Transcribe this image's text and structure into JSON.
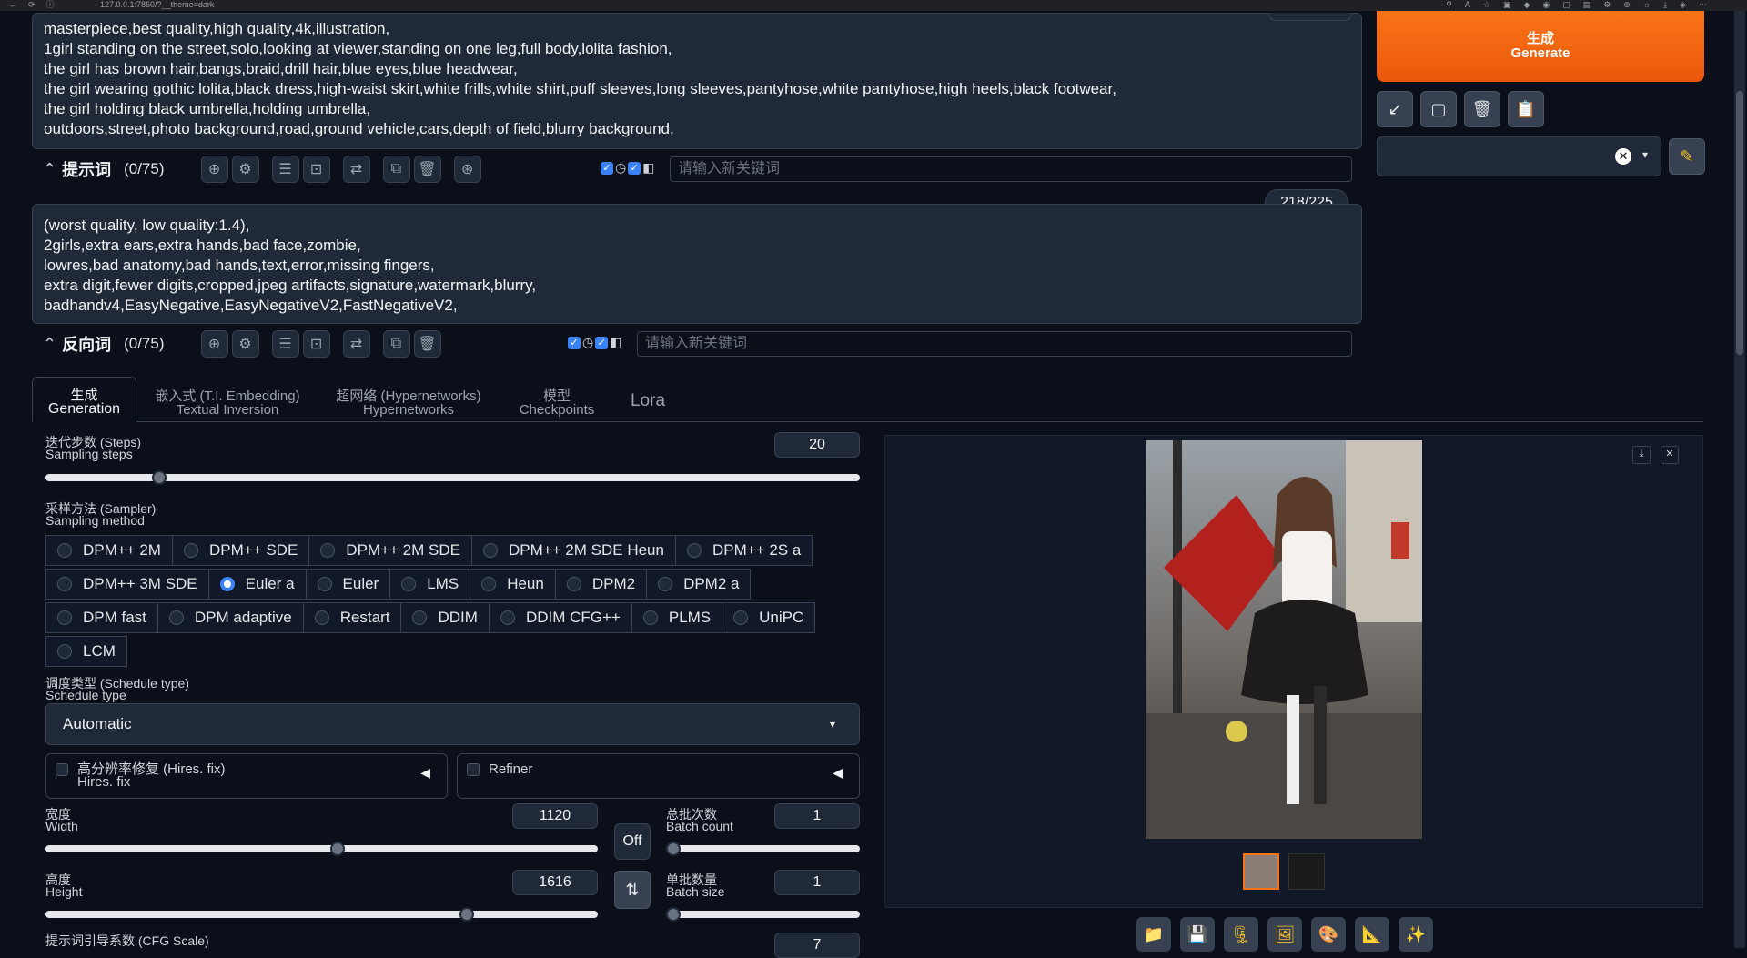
{
  "browser": {
    "url": "127.0.0.1:7860/?__theme=dark"
  },
  "positive": {
    "text": "masterpiece,best quality,high quality,4k,illustration,\n1girl standing on the street,solo,looking at viewer,standing on one leg,full body,lolita fashion,\nthe girl has brown hair,bangs,braid,drill hair,blue eyes,blue headwear,\nthe girl wearing gothic lolita,black dress,high-waist skirt,white frills,white shirt,puff sleeves,long sleeves,pantyhose,white pantyhose,high heels,black footwear,\nthe girl holding black umbrella,holding umbrella,\noutdoors,street,photo background,road,ground vehicle,cars,depth of field,blurry background,",
    "label": "提示词",
    "count": "(0/75)",
    "placeholder": "请输入新关键词"
  },
  "negative": {
    "token_counter": "218/225",
    "text": "(worst quality, low quality:1.4),\n2girls,extra ears,extra hands,bad face,zombie,\nlowres,bad anatomy,bad hands,text,error,missing fingers,\nextra digit,fewer digits,cropped,jpeg artifacts,signature,watermark,blurry,\nbadhandv4,EasyNegative,EasyNegativeV2,FastNegativeV2,",
    "label": "反向词",
    "count": "(0/75)",
    "placeholder": "请输入新关键词"
  },
  "generate": {
    "zh": "生成",
    "en": "Generate"
  },
  "tabs": [
    {
      "zh": "生成",
      "en": "Generation"
    },
    {
      "zh": "嵌入式 (T.I. Embedding)",
      "en": "Textual Inversion"
    },
    {
      "zh": "超网络 (Hypernetworks)",
      "en": "Hypernetworks"
    },
    {
      "zh": "模型",
      "en": "Checkpoints"
    },
    {
      "zh": "",
      "en": "Lora"
    }
  ],
  "steps": {
    "zh": "迭代步数 (Steps)",
    "en": "Sampling steps",
    "value": "20",
    "fraction": 0.133
  },
  "sampler": {
    "zh": "采样方法 (Sampler)",
    "en": "Sampling method",
    "rows": [
      [
        "DPM++ 2M",
        "DPM++ SDE",
        "DPM++ 2M SDE",
        "DPM++ 2M SDE Heun",
        "DPM++ 2S a"
      ],
      [
        "DPM++ 3M SDE",
        "Euler a",
        "Euler",
        "LMS",
        "Heun",
        "DPM2",
        "DPM2 a"
      ],
      [
        "DPM fast",
        "DPM adaptive",
        "Restart",
        "DDIM",
        "DDIM CFG++",
        "PLMS",
        "UniPC"
      ],
      [
        "LCM"
      ]
    ],
    "selected": "Euler a"
  },
  "schedule": {
    "zh": "调度类型 (Schedule type)",
    "en": "Schedule type",
    "value": "Automatic"
  },
  "hires": {
    "zh": "高分辨率修复 (Hires. fix)",
    "en": "Hires. fix"
  },
  "refiner": {
    "label": "Refiner"
  },
  "width": {
    "zh": "宽度",
    "en": "Width",
    "value": "1120",
    "fraction": 0.53
  },
  "height": {
    "zh": "高度",
    "en": "Height",
    "value": "1616",
    "fraction": 0.77
  },
  "off_label": "Off",
  "batch_count": {
    "zh": "总批次数",
    "en": "Batch count",
    "value": "1",
    "fraction": 0.0
  },
  "batch_size": {
    "zh": "单批数量",
    "en": "Batch size",
    "value": "1",
    "fraction": 0.0
  },
  "cfg": {
    "zh": "提示词引导系数 (CFG Scale)",
    "value": "7"
  },
  "colors": {
    "accent": "#f97316",
    "selected_radio": "#3b82f6",
    "bg": "#0b0f19"
  }
}
